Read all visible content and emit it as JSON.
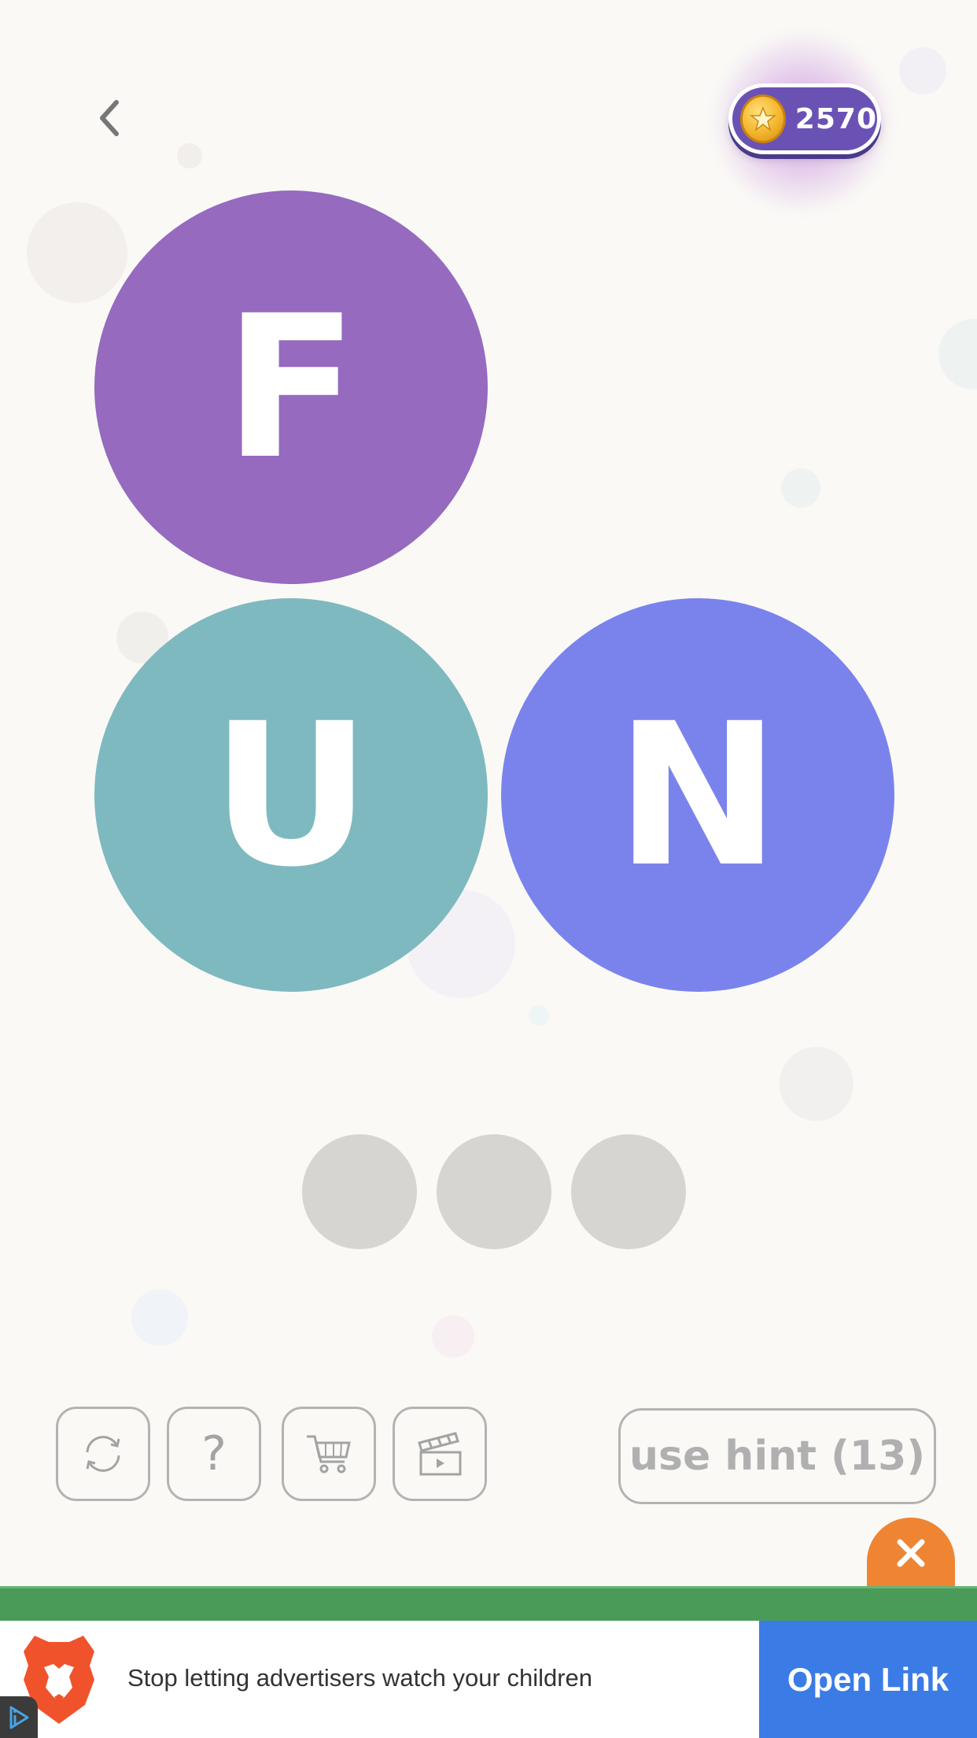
{
  "coins": {
    "count": "2570"
  },
  "tiles": [
    "F",
    "U",
    "N"
  ],
  "colors": {
    "background": "#faf9f6",
    "tile_f": "#956abf",
    "tile_u": "#7fb9c0",
    "tile_n": "#7a83ec",
    "slot": "#d6d5d2",
    "coin_pill": "#6a52b4",
    "ad_close": "#ef8433",
    "ad_strip": "#4a9a58",
    "ad_button": "#3b7be6"
  },
  "answer_slots": [
    "",
    "",
    ""
  ],
  "toolbar": {
    "shuffle_icon": "shuffle-icon",
    "help_label": "?",
    "shop_icon": "cart-icon",
    "video_icon": "video-clapper-icon",
    "hint_label": "use hint (13)"
  },
  "ad": {
    "text": "Stop letting advertisers watch your children",
    "button_label": "Open Link"
  }
}
